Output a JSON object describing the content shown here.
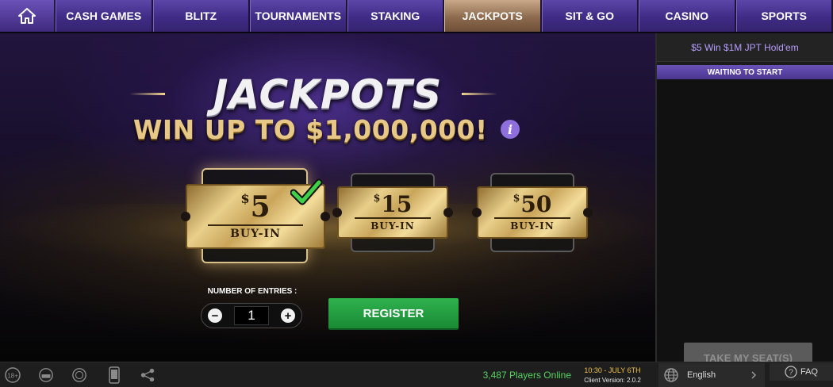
{
  "nav": {
    "tabs": [
      {
        "label": "CASH GAMES"
      },
      {
        "label": "BLITZ"
      },
      {
        "label": "TOURNAMENTS"
      },
      {
        "label": "STAKING"
      },
      {
        "label": "JACKPOTS",
        "active": true
      },
      {
        "label": "SIT & GO"
      },
      {
        "label": "CASINO"
      },
      {
        "label": "SPORTS"
      }
    ]
  },
  "hero": {
    "title": "JACKPOTS",
    "subtitle": "WIN UP TO $1,000,000!",
    "info_icon": "i",
    "tickets": [
      {
        "currency": "$",
        "amount": "5",
        "label": "BUY-IN",
        "selected": true
      },
      {
        "currency": "$",
        "amount": "15",
        "label": "BUY-IN",
        "selected": false
      },
      {
        "currency": "$",
        "amount": "50",
        "label": "BUY-IN",
        "selected": false
      }
    ],
    "entries_label": "NUMBER OF ENTRIES :",
    "entries_value": "1",
    "minus": "−",
    "plus": "+",
    "register_label": "REGISTER"
  },
  "side": {
    "title": "$5 Win $1M JPT Hold'em",
    "status": "WAITING TO START",
    "take_seat_label": "TAKE MY SEAT(S)"
  },
  "footer": {
    "age_badge": "18+",
    "players_online": "3,487 Players Online",
    "time": "10:30 - JULY 6TH",
    "client_version": "Client Version: 2.0.2",
    "language": "English",
    "faq_label": "FAQ"
  },
  "colors": {
    "nav_purple": "#4a3596",
    "active_tab": "#8d6a4e",
    "register_green": "#22a040",
    "players_green": "#55d45f",
    "time_yellow": "#f0c44a",
    "side_title_purple": "#b79cff"
  }
}
